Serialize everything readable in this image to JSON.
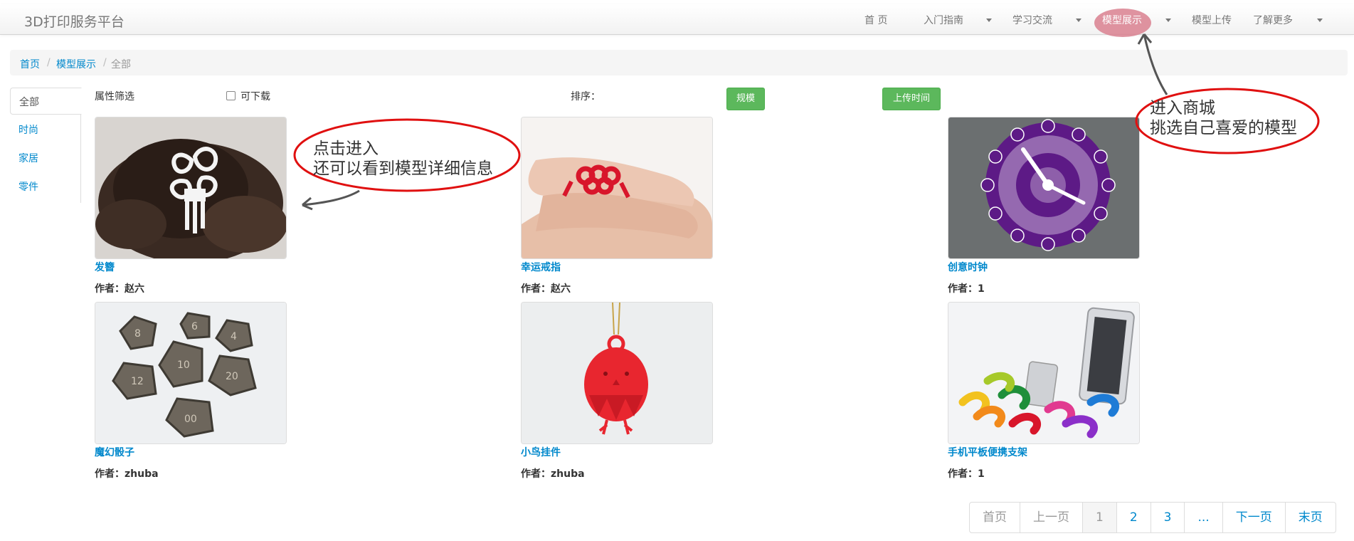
{
  "app": {
    "brand": "3D打印服务平台"
  },
  "nav": {
    "items": [
      {
        "label": "首 页"
      },
      {
        "label": "入门指南"
      },
      {
        "label": "学习交流"
      },
      {
        "label": "模型展示"
      },
      {
        "label": "模型上传"
      },
      {
        "label": "了解更多"
      }
    ]
  },
  "breadcrumb": {
    "home": "首页",
    "models": "模型展示",
    "current": "全部",
    "sep": "/"
  },
  "sidebar": {
    "items": [
      {
        "label": "全部"
      },
      {
        "label": "时尚"
      },
      {
        "label": "家居"
      },
      {
        "label": "零件"
      }
    ]
  },
  "filter": {
    "label": "属性筛选",
    "downloadable": "可下载",
    "sort_label": "排序：",
    "sort_scale": "规模",
    "sort_time": "上传时间"
  },
  "products": [
    {
      "name": "发簪",
      "author": "作者：赵六",
      "image": "hairpin-photo"
    },
    {
      "name": "幸运戒指",
      "author": "作者：赵六",
      "image": "ring-photo"
    },
    {
      "name": "创意时钟",
      "author": "作者：1",
      "image": "clock-photo"
    },
    {
      "name": "魔幻骰子",
      "author": "作者：zhuba",
      "image": "dice-photo"
    },
    {
      "name": "小鸟挂件",
      "author": "作者：zhuba",
      "image": "bird-pendant-photo"
    },
    {
      "name": "手机平板便携支架",
      "author": "作者：1",
      "image": "stand-photo"
    }
  ],
  "annotations": {
    "detail_line1": "点击进入",
    "detail_line2": "还可以看到模型详细信息",
    "shop_line1": "进入商城",
    "shop_line2": "挑选自己喜爱的模型"
  },
  "pagination": {
    "first": "首页",
    "prev": "上一页",
    "p1": "1",
    "p2": "2",
    "p3": "3",
    "ellipsis": "...",
    "next": "下一页",
    "last": "末页"
  },
  "colors": {
    "link": "#0088cc",
    "button_green": "#5cb85c",
    "annotation_red": "#e01010",
    "highlight": "#d9808f"
  }
}
